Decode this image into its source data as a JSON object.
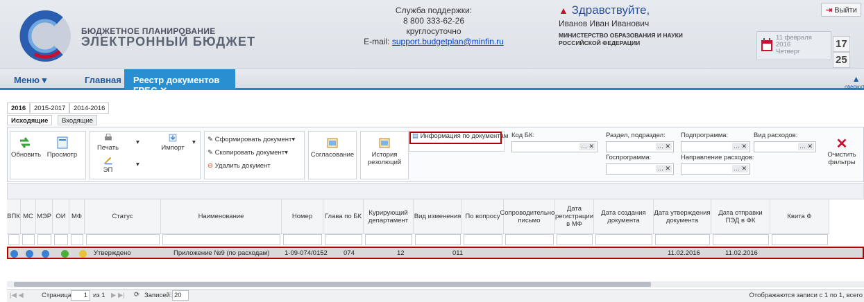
{
  "header": {
    "brand_line1": "БЮДЖЕТНОЕ ПЛАНИРОВАНИЕ",
    "brand_line2": "ЭЛЕКТРОННЫЙ БЮДЖЕТ",
    "support_title": "Служба поддержки:",
    "support_phone": "8 800 333-62-26",
    "support_hours": "круглосуточно",
    "support_email_label": "E-mail:",
    "support_email": "support.budgetplan@minfin.ru",
    "greeting": "Здравствуйте,",
    "user_name": "Иванов Иван Иванович",
    "org_line1": "МИНИСТЕРСТВО ОБРАЗОВАНИЯ И НАУКИ",
    "org_line2": "РОССИЙСКОЙ ФЕДЕРАЦИИ",
    "exit_label": "Выйти",
    "date_day": "11 февраля",
    "date_year": "2016",
    "date_weekday": "Четверг",
    "time_h": "17",
    "time_m": "25"
  },
  "nav": {
    "menu": "Меню ▾",
    "home": "Главная",
    "active_tab": "Реестр документов ГРБС",
    "collapse": "свернуть"
  },
  "years": [
    "2016",
    "2015-2017",
    "2014-2016"
  ],
  "subtabs": [
    "Исходящие",
    "Входящие"
  ],
  "toolbar": {
    "refresh": "Обновить",
    "view": "Просмотр",
    "print": "Печать",
    "ep": "ЭП",
    "import": "Импорт",
    "form_doc": "Сформировать документ",
    "copy_doc": "Скопировать документ",
    "delete_doc": "Удалить документ",
    "approve": "Согласование",
    "history1": "История",
    "history2": "резолюций",
    "info_docs": "Информация по документам",
    "kod_bk": "Код БК:",
    "razdel": "Раздел, подраздел:",
    "podprog": "Подпрограмма:",
    "vid_rash": "Вид расходов:",
    "gosprog": "Госпрограмма:",
    "napr": "Направление расходов:",
    "clear1": "Очистить",
    "clear2": "фильтры"
  },
  "columns": [
    "ВПК",
    "МС",
    "МЭР",
    "ОИ",
    "МФ",
    "Статус",
    "Наименование",
    "Номер",
    "Глава по БК",
    "Курирующий департамент",
    "Вид изменения",
    "По вопросу",
    "Сопроводительное письмо",
    "Дата регистрации в МФ",
    "Дата создания документа",
    "Дата утверждения документа",
    "Дата отправки ПЭД в ФК",
    "Квита Ф"
  ],
  "row": {
    "dot_colors": [
      "#3a7fd0",
      "#3a7fd0",
      "#3a7fd0",
      "#4caf3a",
      "#e8c33a"
    ],
    "status": "Утверждено",
    "name": "Приложение №9 (по расходам)",
    "number": "1-09-074/0152",
    "glava": "074",
    "dept": "12",
    "vid": "011",
    "date_create": "11.02.2016",
    "date_approve": "11.02.2016"
  },
  "pager": {
    "page_label": "Страница",
    "page": "1",
    "of": "из 1",
    "records_label": "Записей:",
    "records": "20",
    "status": "Отображаются записи с 1 по 1, всего"
  }
}
